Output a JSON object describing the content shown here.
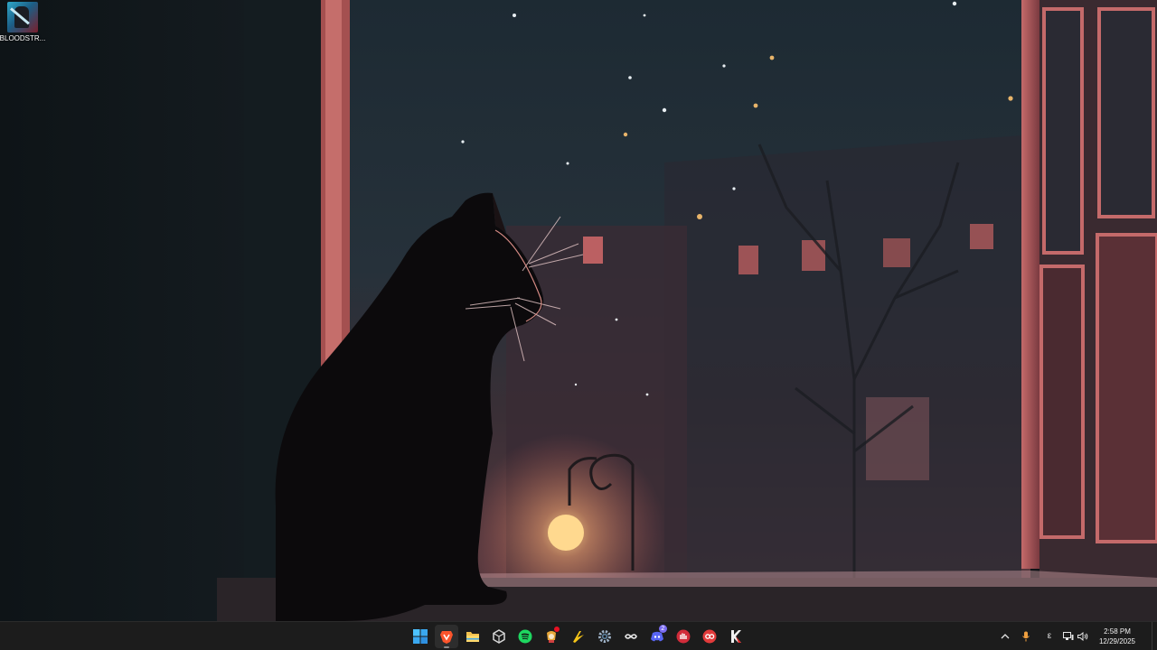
{
  "desktop": {
    "icons": [
      {
        "label": "BLOODSTR...",
        "icon": "bloodstrike-game-icon"
      }
    ]
  },
  "taskbar": {
    "apps": [
      {
        "name": "start",
        "icon": "windows-start-icon",
        "active": false
      },
      {
        "name": "brave",
        "icon": "brave-browser-icon",
        "active": true
      },
      {
        "name": "file-explorer",
        "icon": "folder-icon",
        "active": false
      },
      {
        "name": "unity",
        "icon": "unity-cube-icon",
        "active": false
      },
      {
        "name": "spotify",
        "icon": "spotify-icon",
        "active": false
      },
      {
        "name": "lol-app",
        "icon": "game-character-icon",
        "active": false,
        "badge": ""
      },
      {
        "name": "app-yellow",
        "icon": "yellow-arrow-icon",
        "active": false
      },
      {
        "name": "settings",
        "icon": "gear-icon",
        "active": false
      },
      {
        "name": "app-infinity",
        "icon": "infinity-logo-icon",
        "active": false
      },
      {
        "name": "discord",
        "icon": "discord-icon",
        "active": false,
        "badge": "2"
      },
      {
        "name": "app-red-hand",
        "icon": "red-hand-icon",
        "active": false
      },
      {
        "name": "app-red-circle",
        "icon": "red-circle-icon",
        "active": false
      },
      {
        "name": "app-k",
        "icon": "k-logo-icon",
        "active": false
      }
    ]
  },
  "tray": {
    "chevron_icon": "chevron-up-icon",
    "mic_icon": "microphone-icon",
    "input_indicator": "ε",
    "network_icon": "network-icon",
    "volume_icon": "speaker-icon",
    "time": "2:58 PM",
    "date": "12/29/2025"
  }
}
